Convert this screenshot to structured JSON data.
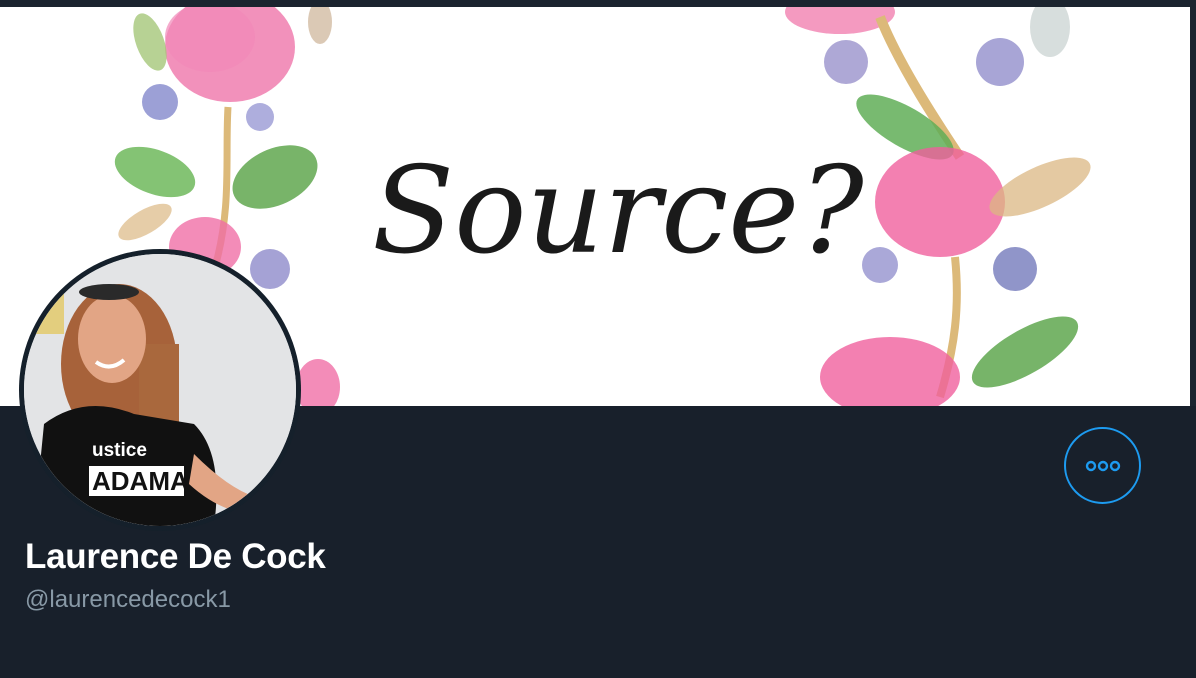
{
  "banner": {
    "text": "Source?"
  },
  "avatar": {
    "shirt_text_line1": "ustice",
    "shirt_text_line2": "ADAMA"
  },
  "profile": {
    "display_name": "Laurence De Cock",
    "handle": "@laurencedecock1"
  },
  "actions": {
    "more_icon": "more-horizontal-icon"
  },
  "colors": {
    "background": "#18202b",
    "accent": "#1d9bf0",
    "name": "#ffffff",
    "handle": "#8899a6"
  }
}
